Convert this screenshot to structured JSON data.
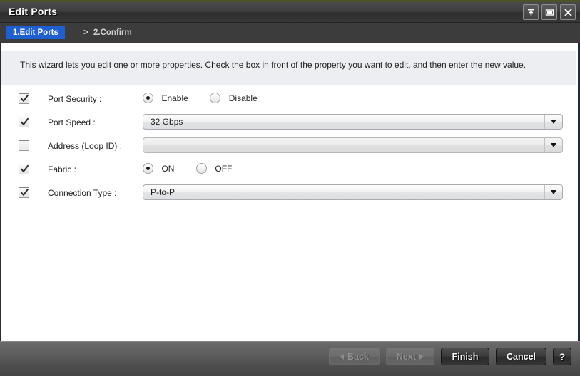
{
  "window": {
    "title": "Edit Ports",
    "title_buttons": [
      {
        "name": "pin-icon",
        "label": "Pin"
      },
      {
        "name": "maximize-icon",
        "label": "Maximize"
      },
      {
        "name": "close-icon",
        "label": "Close"
      }
    ]
  },
  "steps": {
    "current": "1.Edit Ports",
    "separator": ">",
    "next": "2.Confirm"
  },
  "description": "This wizard lets you edit one or more properties. Check the  box in front of the property you want to edit, and then enter the new value.",
  "form": {
    "rows": [
      {
        "label": "Port Security :",
        "checked": true,
        "control": "radio",
        "options": [
          "Enable",
          "Disable"
        ],
        "selected": "Enable"
      },
      {
        "label": "Port Speed :",
        "checked": true,
        "control": "dropdown",
        "value": "32 Gbps",
        "enabled": true
      },
      {
        "label": "Address (Loop ID) :",
        "checked": false,
        "control": "dropdown",
        "value": "",
        "enabled": false
      },
      {
        "label": "Fabric :",
        "checked": true,
        "control": "radio",
        "options": [
          "ON",
          "OFF"
        ],
        "selected": "ON"
      },
      {
        "label": "Connection Type :",
        "checked": true,
        "control": "dropdown",
        "value": "P-to-P",
        "enabled": true
      }
    ]
  },
  "footer": {
    "back": "Back",
    "next": "Next",
    "finish": "Finish",
    "cancel": "Cancel",
    "help": "?"
  },
  "colors": {
    "accent": "#1e5fd1",
    "titlebar": "#3e3e3e",
    "panel": "#ffffff",
    "desc_bg": "#eceef1",
    "footer": "#5e5e5e",
    "top_strip": "#4b5329"
  }
}
